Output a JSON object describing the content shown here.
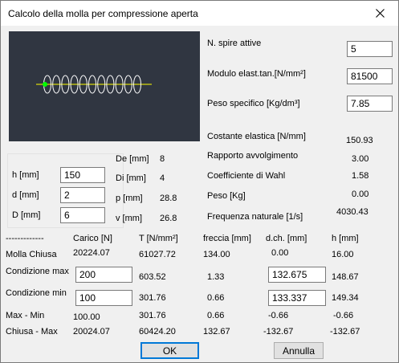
{
  "window": {
    "title": "Calcolo della molla per compressione aperta"
  },
  "params": {
    "spire_label": "N. spire attive",
    "spire_value": "5",
    "modulo_label": "Modulo elast.tan.[N/mm²]",
    "modulo_value": "81500",
    "peso_spec_label": "Peso specifico [Kg/dm³]",
    "peso_spec_value": "7.85"
  },
  "results": [
    {
      "label": "Costante elastica [N/mm]",
      "value": "150.93"
    },
    {
      "label": "Rapporto avvolgimento",
      "value": "3.00"
    },
    {
      "label": "Coefficiente di Wahl",
      "value": "1.58"
    },
    {
      "label": "Peso [Kg]",
      "value": "0.00"
    },
    {
      "label": "Frequenza naturale [1/s]",
      "value": "4030.43"
    }
  ],
  "dims": {
    "h_label": "h [mm]",
    "h_value": "150",
    "d_label": "d [mm]",
    "d_value": "2",
    "D_label": "D [mm]",
    "D_value": "6"
  },
  "derived": [
    {
      "label": "De [mm]",
      "value": "8"
    },
    {
      "label": "Di [mm]",
      "value": "4"
    },
    {
      "label": "p [mm]",
      "value": "28.8"
    },
    {
      "label": "v [mm]",
      "value": "26.8"
    }
  ],
  "table": {
    "headers": [
      "-------------",
      "Carico [N]",
      "T [N/mm²]",
      "freccia [mm]",
      "d.ch. [mm]",
      "h [mm]"
    ],
    "molla_chiusa": {
      "label": "Molla  Chiusa",
      "carico": "20224.07",
      "t": "61027.72",
      "freccia": "134.00",
      "dch": "0.00",
      "h": "16.00"
    },
    "cond_max": {
      "label": "Condizione max",
      "carico": "200",
      "t": "603.52",
      "freccia": "1.33",
      "dch": "132.675",
      "h": "148.67"
    },
    "cond_min": {
      "label": "Condizione min",
      "carico": "100",
      "t": "301.76",
      "freccia": "0.66",
      "dch": "133.337",
      "h": "149.34"
    },
    "max_min": {
      "label": "Max   -   Min",
      "carico": "100.00",
      "t": "301.76",
      "freccia": "0.66",
      "dch": "-0.66",
      "h": "-0.66"
    },
    "chiusa_max": {
      "label": "Chiusa  -  Max",
      "carico": "20024.07",
      "t": "60424.20",
      "freccia": "132.67",
      "dch": "-132.67",
      "h": "-132.67"
    }
  },
  "buttons": {
    "ok": "OK",
    "annulla": "Annulla"
  },
  "colors": {
    "preview_bg": "#303641",
    "spring": "#ffffff",
    "axis": "#ffff00",
    "marker": "#00ff00",
    "accent": "#0078d7"
  }
}
